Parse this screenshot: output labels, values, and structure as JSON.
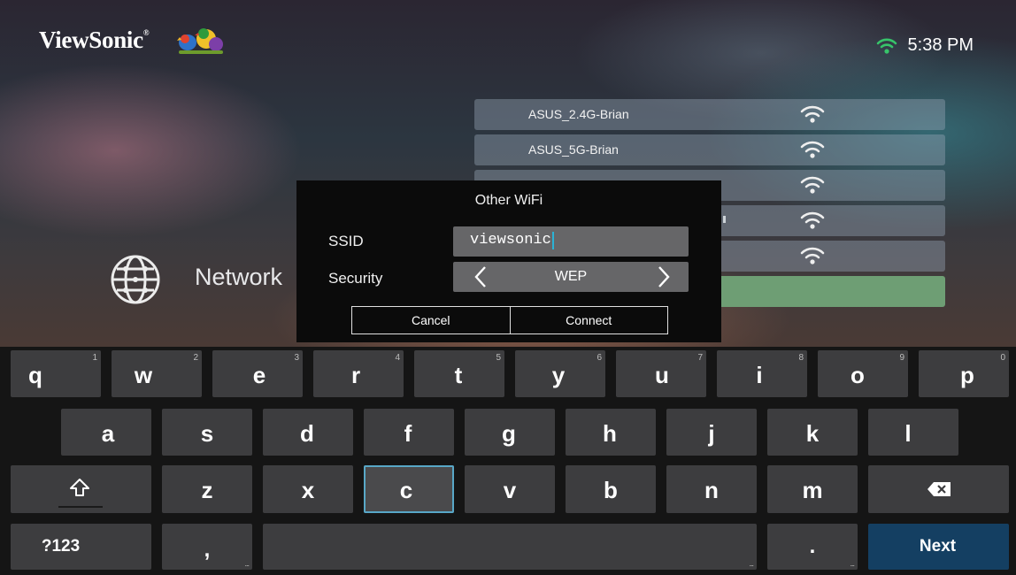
{
  "header": {
    "brand": "ViewSonic",
    "brand_mark": "®",
    "time": "5:38 PM",
    "wifi_status_icon": "wifi-icon"
  },
  "sidebar": {
    "network_label": "Network",
    "network_icon": "globe-icon"
  },
  "wifi_networks": [
    {
      "ssid": "ASUS_2.4G-Brian",
      "icon": "wifi-signal-icon"
    },
    {
      "ssid": "ASUS_5G-Brian",
      "icon": "wifi-signal-icon"
    },
    {
      "ssid": "",
      "icon": "wifi-signal-icon"
    },
    {
      "ssid": "",
      "icon": "wifi-signal-icon"
    },
    {
      "ssid": "",
      "icon": "wifi-signal-icon"
    },
    {
      "ssid": "",
      "icon": ""
    }
  ],
  "dialog": {
    "title": "Other WiFi",
    "ssid_label": "SSID",
    "ssid_value": "viewsonic",
    "security_label": "Security",
    "security_value": "WEP",
    "cancel_label": "Cancel",
    "connect_label": "Connect"
  },
  "keyboard": {
    "row1": [
      {
        "ch": "q",
        "num": "1"
      },
      {
        "ch": "w",
        "num": "2"
      },
      {
        "ch": "e",
        "num": "3"
      },
      {
        "ch": "r",
        "num": "4"
      },
      {
        "ch": "t",
        "num": "5"
      },
      {
        "ch": "y",
        "num": "6"
      },
      {
        "ch": "u",
        "num": "7"
      },
      {
        "ch": "i",
        "num": "8"
      },
      {
        "ch": "o",
        "num": "9"
      },
      {
        "ch": "p",
        "num": "0"
      }
    ],
    "row2": [
      "a",
      "s",
      "d",
      "f",
      "g",
      "h",
      "j",
      "k",
      "l"
    ],
    "row3": [
      "z",
      "x",
      "c",
      "v",
      "b",
      "n",
      "m"
    ],
    "shift_icon": "shift-icon",
    "backspace_icon": "backspace-icon",
    "symbols_label": "?123",
    "comma_label": ",",
    "period_label": ".",
    "more_dots": "...",
    "next_label": "Next",
    "accent_color": "#143f62",
    "focus_color": "#58a7c7"
  }
}
